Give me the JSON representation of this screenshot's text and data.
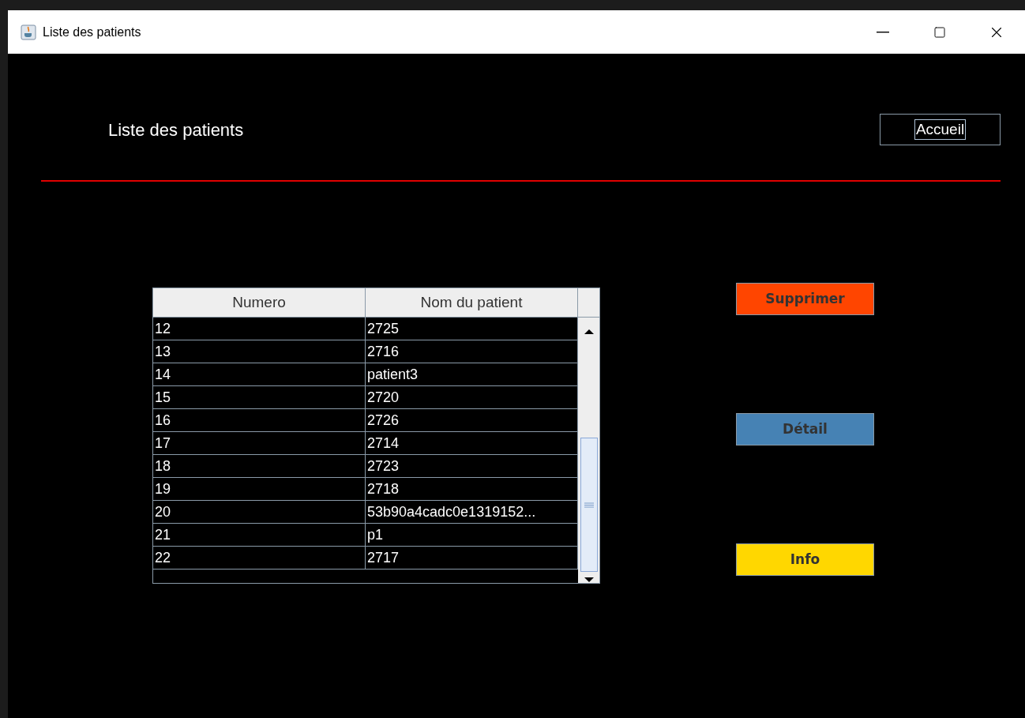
{
  "window": {
    "title": "Liste des patients"
  },
  "heading": "Liste des patients",
  "home_button": {
    "label": "Accueil",
    "focused": true
  },
  "table": {
    "columns": [
      "Numero",
      "Nom du patient"
    ],
    "rows": [
      {
        "cells": [
          "12",
          "2725"
        ]
      },
      {
        "cells": [
          "13",
          "2716"
        ]
      },
      {
        "cells": [
          "14",
          "patient3"
        ]
      },
      {
        "cells": [
          "15",
          "2720"
        ]
      },
      {
        "cells": [
          "16",
          "2726"
        ]
      },
      {
        "cells": [
          "17",
          "2714"
        ]
      },
      {
        "cells": [
          "18",
          "2723"
        ]
      },
      {
        "cells": [
          "19",
          "2718"
        ]
      },
      {
        "cells": [
          "20",
          "53b90a4cadc0e1319152..."
        ]
      },
      {
        "cells": [
          "21",
          "p1"
        ]
      },
      {
        "cells": [
          "22",
          "2717"
        ]
      }
    ]
  },
  "actions": [
    {
      "label": "Supprimer",
      "color": "#ff4500"
    },
    {
      "label": "Détail",
      "color": "#4682b4"
    },
    {
      "label": "Info",
      "color": "#ffd700"
    }
  ]
}
